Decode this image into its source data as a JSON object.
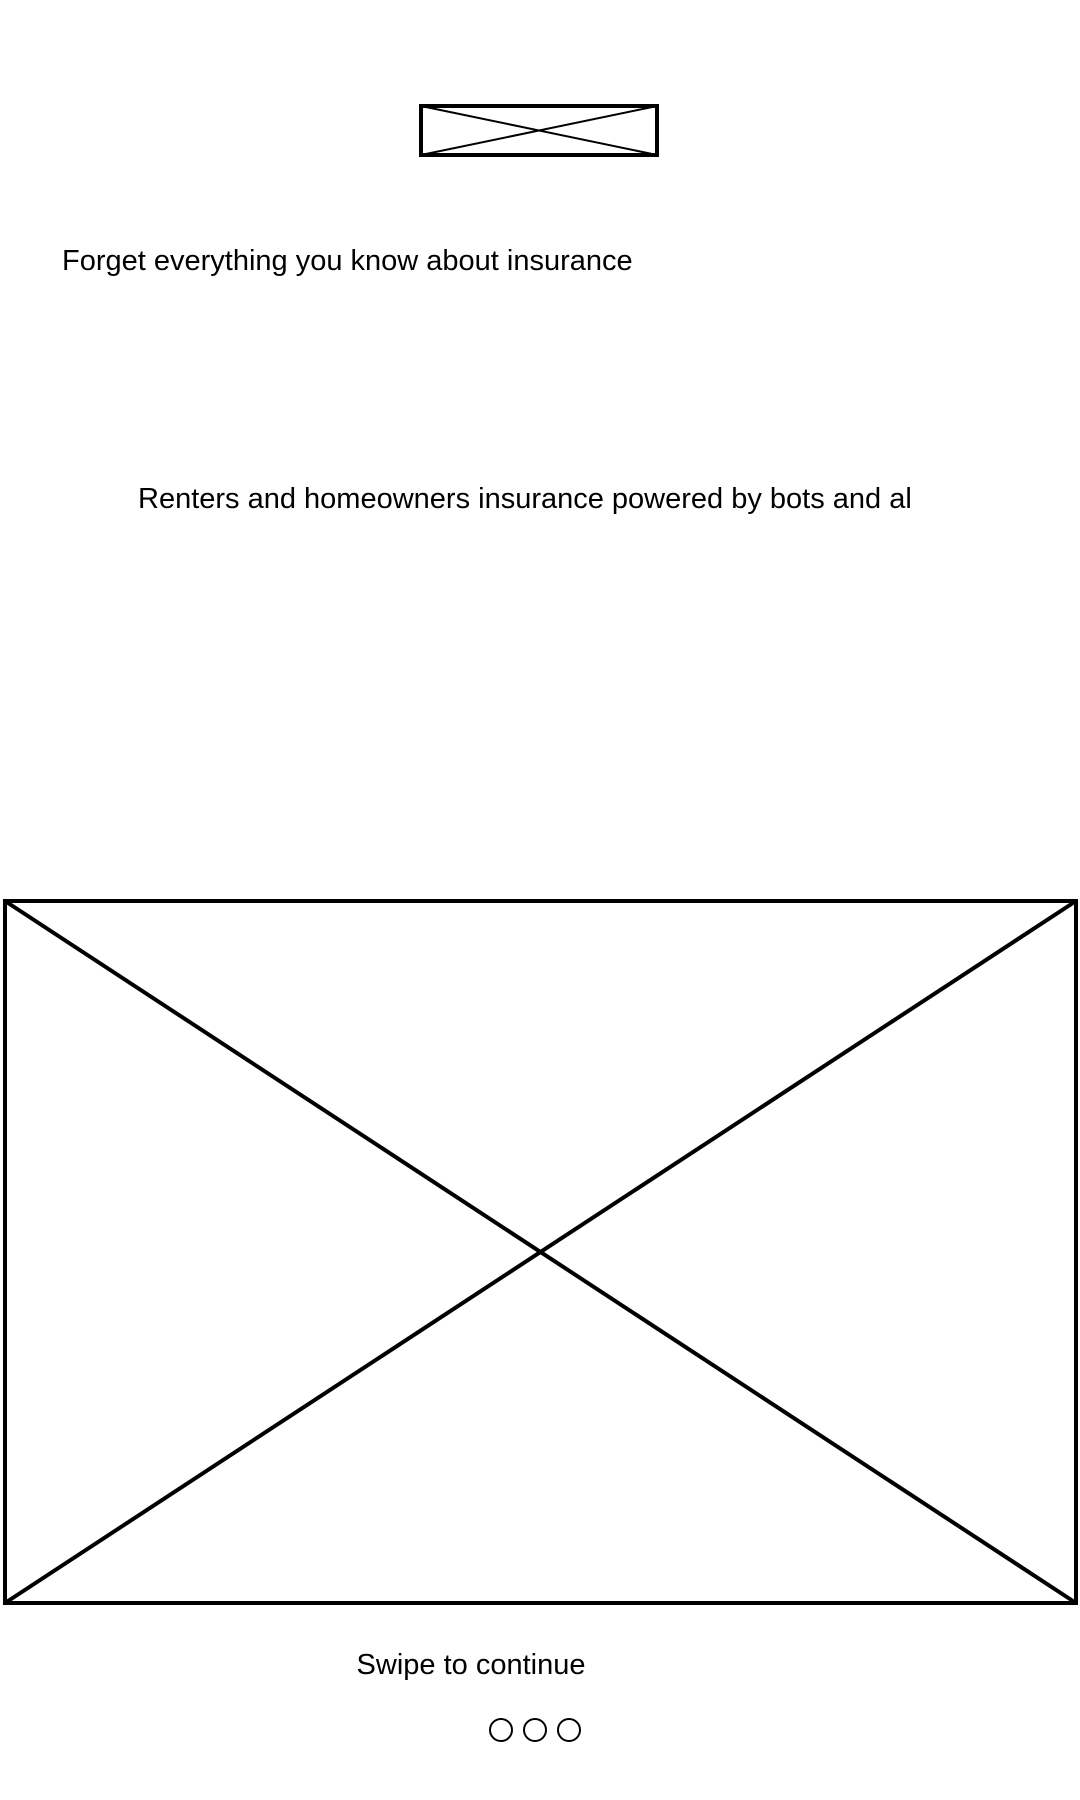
{
  "screen": {
    "headline": "Forget everything you know about insurance",
    "subheadline": "Renters and homeowners insurance powered by bots and al",
    "swipe_hint": "Swipe to continue",
    "pager": {
      "page_count": 3,
      "current_index": 0
    }
  },
  "images": {
    "logo": "logo-image-placeholder",
    "hero": "hero-image-placeholder"
  },
  "colors": {
    "background": "#ffffff",
    "foreground": "#000000"
  }
}
